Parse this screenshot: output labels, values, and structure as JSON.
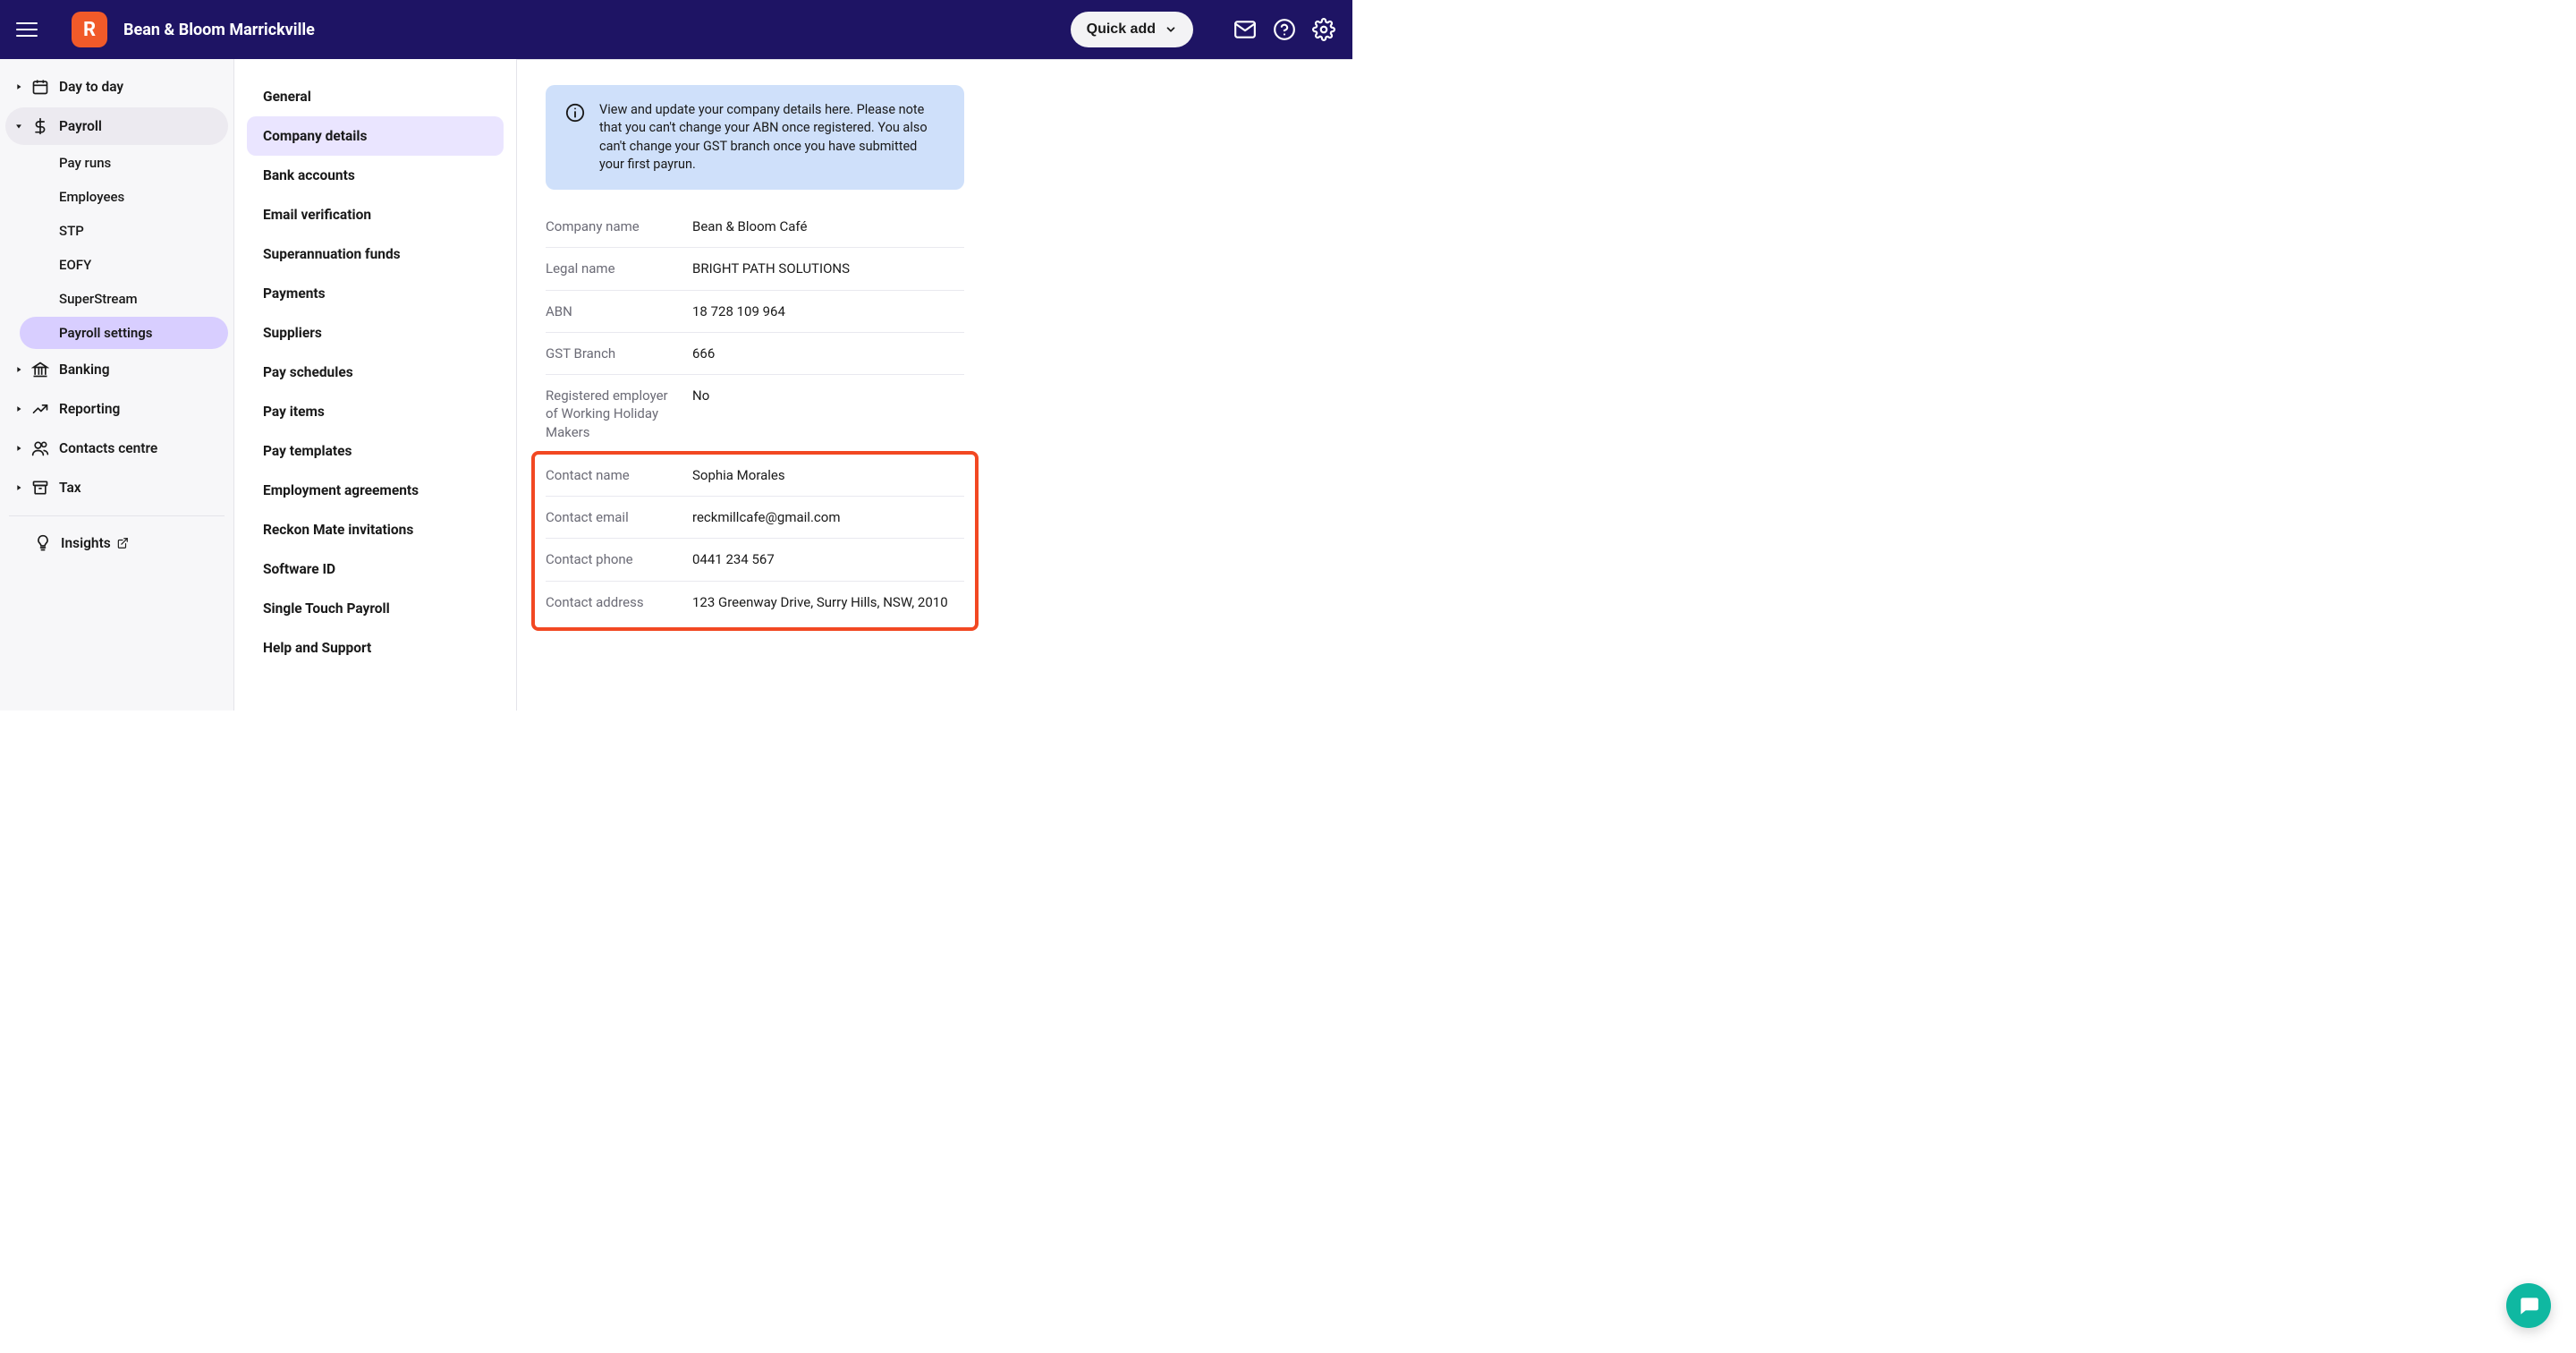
{
  "header": {
    "company": "Bean & Bloom Marrickville",
    "brand_letter": "R",
    "quick_add": "Quick add"
  },
  "sidebar": {
    "items": [
      {
        "label": "Day to day"
      },
      {
        "label": "Payroll"
      },
      {
        "label": "Banking"
      },
      {
        "label": "Reporting"
      },
      {
        "label": "Contacts centre"
      },
      {
        "label": "Tax"
      }
    ],
    "payroll_sub": [
      {
        "label": "Pay runs"
      },
      {
        "label": "Employees"
      },
      {
        "label": "STP"
      },
      {
        "label": "EOFY"
      },
      {
        "label": "SuperStream"
      },
      {
        "label": "Payroll settings"
      }
    ],
    "insights": "Insights"
  },
  "settings_menu": [
    "General",
    "Company details",
    "Bank accounts",
    "Email verification",
    "Superannuation funds",
    "Payments",
    "Suppliers",
    "Pay schedules",
    "Pay items",
    "Pay templates",
    "Employment agreements",
    "Reckon Mate invitations",
    "Software ID",
    "Single Touch Payroll",
    "Help and Support"
  ],
  "info_text": "View and update your company details here. Please note that you can't change your ABN once registered. You also can't change your GST branch once you have submitted your first payrun.",
  "details": {
    "company_name": {
      "label": "Company name",
      "value": "Bean & Bloom Café"
    },
    "legal_name": {
      "label": "Legal name",
      "value": "BRIGHT PATH SOLUTIONS"
    },
    "abn": {
      "label": "ABN",
      "value": "18 728 109 964"
    },
    "gst_branch": {
      "label": "GST Branch",
      "value": "666"
    },
    "whm": {
      "label": "Registered employer of Working Holiday Makers",
      "value": "No"
    },
    "contact_name": {
      "label": "Contact name",
      "value": "Sophia Morales"
    },
    "contact_email": {
      "label": "Contact email",
      "value": "reckmillcafe@gmail.com"
    },
    "contact_phone": {
      "label": "Contact phone",
      "value": "0441 234 567"
    },
    "contact_address": {
      "label": "Contact address",
      "value": "123 Greenway Drive, Surry Hills, NSW, 2010"
    }
  }
}
